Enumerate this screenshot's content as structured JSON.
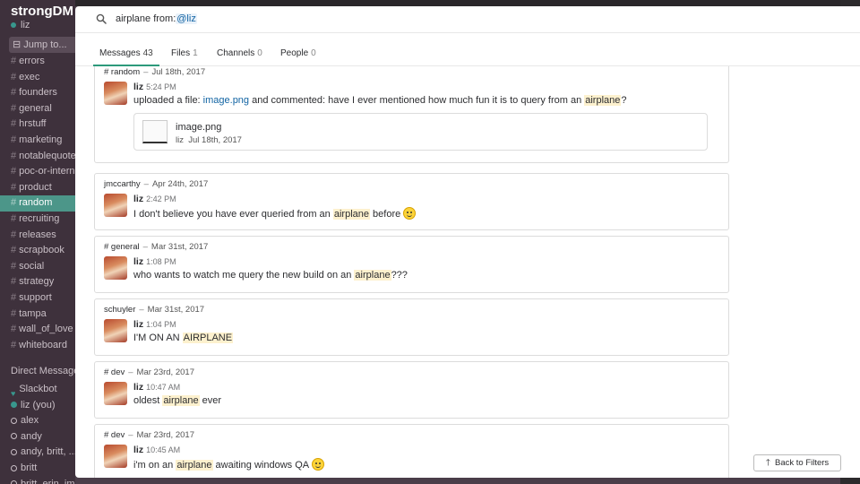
{
  "sidebar": {
    "team_name": "strongDM",
    "current_user": "liz",
    "jump_placeholder": "Jump to...",
    "channels": [
      "errors",
      "exec",
      "founders",
      "general",
      "hrstuff",
      "marketing",
      "notablequotes",
      "poc-or-internal",
      "product",
      "random",
      "recruiting",
      "releases",
      "scrapbook",
      "social",
      "strategy",
      "support",
      "tampa",
      "wall_of_love",
      "whiteboard"
    ],
    "active_channel": "random",
    "dm_title": "Direct Messages",
    "dms": [
      {
        "name": "Slackbot",
        "presence": "heart"
      },
      {
        "name": "liz (you)",
        "presence": "on"
      },
      {
        "name": "alex",
        "presence": "off"
      },
      {
        "name": "andy",
        "presence": "off"
      },
      {
        "name": "andy, britt, ...",
        "presence": "off"
      },
      {
        "name": "britt",
        "presence": "off"
      },
      {
        "name": "britt, erin, jmccarthy",
        "presence": "off"
      }
    ]
  },
  "search": {
    "query_prefix": "airplane from:",
    "mention": "@liz"
  },
  "tabs": [
    {
      "label": "Messages",
      "count": "43"
    },
    {
      "label": "Files",
      "count": "1"
    },
    {
      "label": "Channels",
      "count": "0"
    },
    {
      "label": "People",
      "count": "0"
    }
  ],
  "results": [
    {
      "channel": "# random",
      "date": "Jul 18th, 2017",
      "user": "liz",
      "time": "5:24 PM",
      "text_before": "uploaded a file: ",
      "link": "image.png",
      "text_mid": " and commented: have I ever mentioned how much fun it is to query from an ",
      "highlight": "airplane",
      "text_after": "?",
      "file": {
        "name": "image.png",
        "user": "liz",
        "date": "Jul 18th, 2017"
      }
    },
    {
      "channel": "jmccarthy",
      "date": "Apr 24th, 2017",
      "user": "liz",
      "time": "2:42 PM",
      "text_before": "I don't believe you have ever queried from an ",
      "highlight": "airplane",
      "text_after": " before",
      "emoji": "slightly-smiling-face"
    },
    {
      "channel": "# general",
      "date": "Mar 31st, 2017",
      "user": "liz",
      "time": "1:08 PM",
      "text_before": "who wants to watch me query the new build on an ",
      "highlight": "airplane",
      "text_after": "???"
    },
    {
      "channel": "schuyler",
      "date": "Mar 31st, 2017",
      "user": "liz",
      "time": "1:04 PM",
      "text_before": "I'M ON AN ",
      "highlight": "AIRPLANE",
      "text_after": ""
    },
    {
      "channel": "# dev",
      "date": "Mar 23rd, 2017",
      "user": "liz",
      "time": "10:47 AM",
      "text_before": "oldest ",
      "highlight": "airplane",
      "text_after": " ever"
    },
    {
      "channel": "# dev",
      "date": "Mar 23rd, 2017",
      "user": "liz",
      "time": "10:45 AM",
      "text_before": "i'm on an ",
      "highlight": "airplane",
      "text_after": " awaiting windows QA",
      "emoji": "slightly-smiling-face"
    }
  ],
  "back_button": "Back to Filters",
  "dash": "–"
}
